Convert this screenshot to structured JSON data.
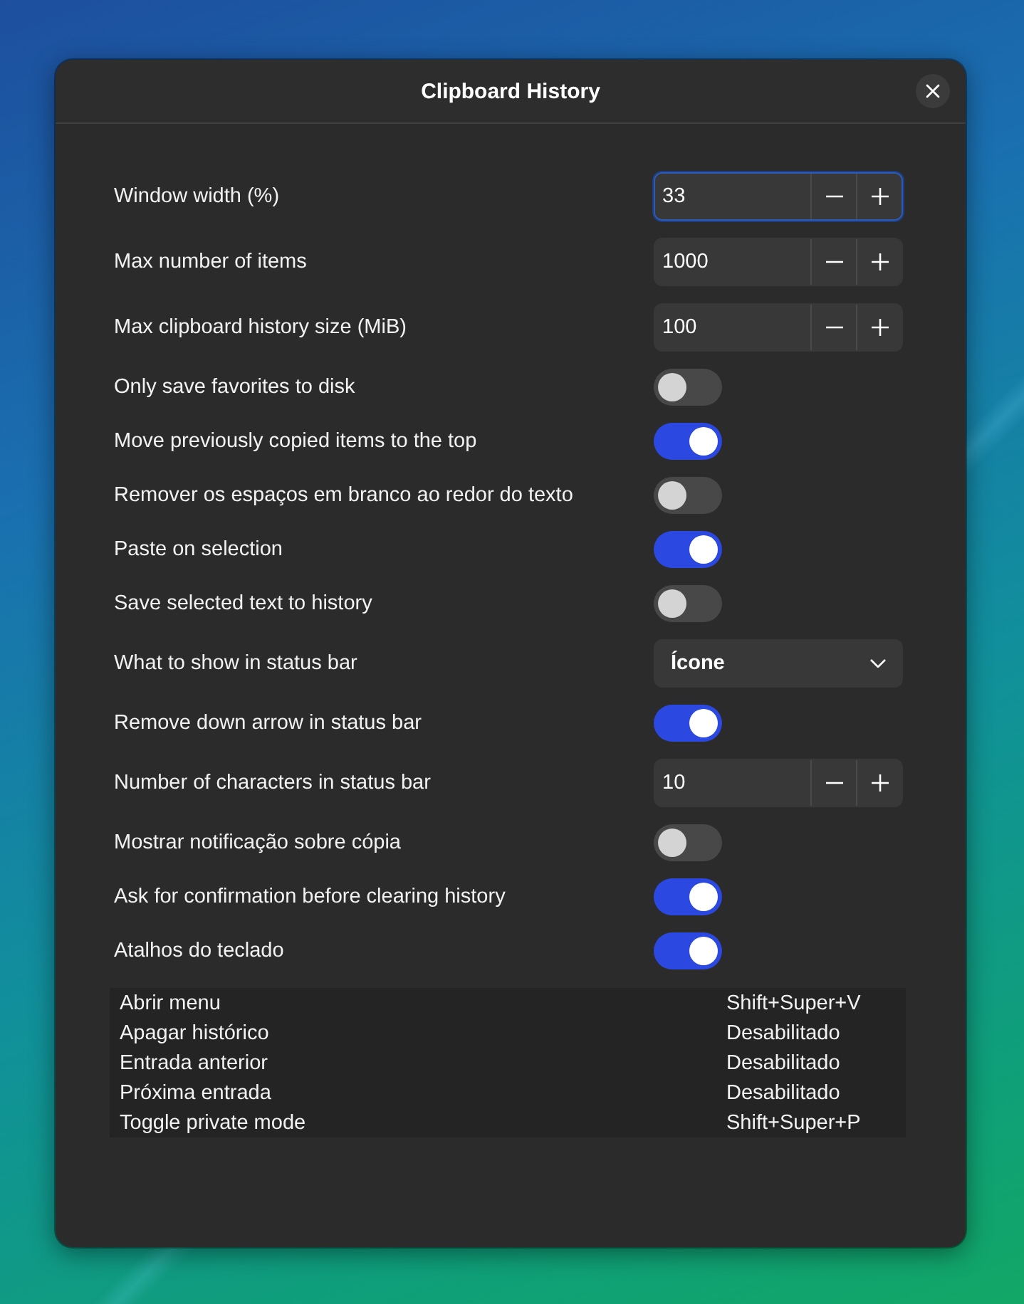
{
  "window": {
    "title": "Clipboard History"
  },
  "settings": [
    {
      "kind": "spin",
      "label": "Window width (%)",
      "value": "33",
      "focused": true
    },
    {
      "kind": "spin",
      "label": "Max number of items",
      "value": "1000",
      "focused": false
    },
    {
      "kind": "spin",
      "label": "Max clipboard history size (MiB)",
      "value": "100",
      "focused": false
    },
    {
      "kind": "switch",
      "label": "Only save favorites to disk",
      "on": false
    },
    {
      "kind": "switch",
      "label": "Move previously copied items to the top",
      "on": true
    },
    {
      "kind": "switch",
      "label": "Remover os espaços em branco ao redor do texto",
      "on": false
    },
    {
      "kind": "switch",
      "label": "Paste on selection",
      "on": true
    },
    {
      "kind": "switch",
      "label": "Save selected text to history",
      "on": false
    },
    {
      "kind": "dropdown",
      "label": "What to show in status bar",
      "value": "Ícone"
    },
    {
      "kind": "switch",
      "label": "Remove down arrow in status bar",
      "on": true
    },
    {
      "kind": "spin",
      "label": "Number of characters in status bar",
      "value": "10",
      "focused": false
    },
    {
      "kind": "switch",
      "label": "Mostrar notificação sobre cópia",
      "on": false
    },
    {
      "kind": "switch",
      "label": "Ask for confirmation before clearing history",
      "on": true
    },
    {
      "kind": "switch",
      "label": "Atalhos do teclado",
      "on": true
    }
  ],
  "shortcuts": [
    {
      "action": "Abrir menu",
      "keys": "Shift+Super+V"
    },
    {
      "action": "Apagar histórico",
      "keys": "Desabilitado"
    },
    {
      "action": "Entrada anterior",
      "keys": "Desabilitado"
    },
    {
      "action": "Próxima entrada",
      "keys": "Desabilitado"
    },
    {
      "action": "Toggle private mode",
      "keys": "Shift+Super+P"
    }
  ]
}
